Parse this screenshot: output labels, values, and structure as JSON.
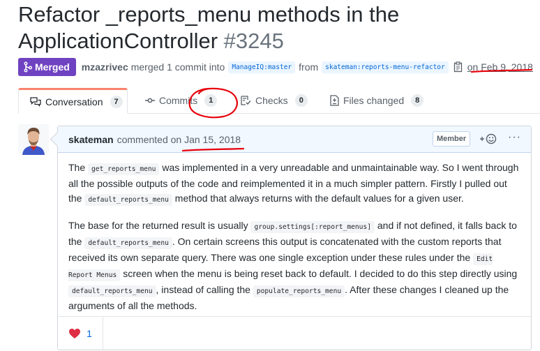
{
  "pr": {
    "title": "Refactor _reports_menu methods in the ApplicationController",
    "number": "#3245",
    "status": "Merged",
    "author": "mzazrivec",
    "merged_text": "merged 1 commit into",
    "base_ref": "ManageIQ:master",
    "from_text": "from",
    "head_ref": "skateman:reports-menu-refactor",
    "date": "on Feb 9, 2018"
  },
  "tabs": [
    {
      "label": "Conversation",
      "count": "7"
    },
    {
      "label": "Commits",
      "count": "1"
    },
    {
      "label": "Checks",
      "count": "0"
    },
    {
      "label": "Files changed",
      "count": "8"
    }
  ],
  "comment": {
    "author": "skateman",
    "action": "commented on",
    "date": "Jan 15, 2018",
    "role": "Member",
    "reaction_count": "1",
    "p1": {
      "t1": "The ",
      "c1": "get_reports_menu",
      "t2": " was implemented in a very unreadable and unmaintainable way. So I went through all the possible outputs of the code and reimplemented it in a much simpler pattern. Firstly I pulled out the ",
      "c2": "default_reports_menu",
      "t3": " method that always returns with the default values for a given user."
    },
    "p2": {
      "t1": "The base for the returned result is usually ",
      "c1": "group.settings[:report_menus]",
      "t2": " and if not defined, it falls back to the ",
      "c2": "default_reports_menu",
      "t3": ". On certain screens this output is concatenated with the custom reports that received its own separate query. There was one single exception under these rules under the ",
      "c3": "Edit Report Menus",
      "t4": " screen when the menu is being reset back to default. I decided to do this step directly using ",
      "c4": "default_reports_menu",
      "t5": ", instead of calling the ",
      "c5": "populate_reports_menu",
      "t6": ". After these changes I cleaned up the arguments of all the methods."
    }
  },
  "colors": {
    "merged": "#6f42c1",
    "link": "#0366d6",
    "annotation": "#e8000b"
  }
}
